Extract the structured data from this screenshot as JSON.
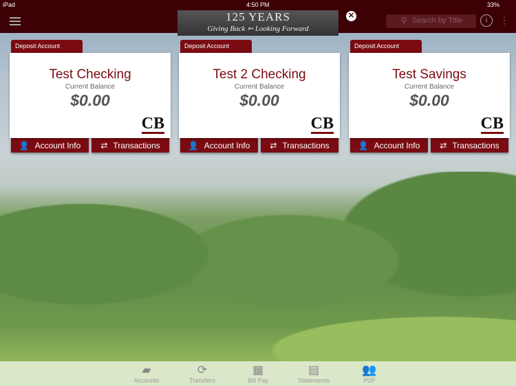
{
  "status": {
    "device": "iPad",
    "time": "4:50 PM",
    "battery": "33%"
  },
  "banner": {
    "line1": "125 YEARS",
    "line2": "Giving Back ➳ Looking Forward"
  },
  "search": {
    "placeholder": "Search by Title"
  },
  "accounts": [
    {
      "type": "Deposit Account",
      "name": "Test Checking",
      "balance_label": "Current Balance",
      "balance": "$0.00",
      "logo": "CB",
      "info_label": "Account Info",
      "transactions_label": "Transactions"
    },
    {
      "type": "Deposit Account",
      "name": "Test 2 Checking",
      "balance_label": "Current Balance",
      "balance": "$0.00",
      "logo": "CB",
      "info_label": "Account Info",
      "transactions_label": "Transactions"
    },
    {
      "type": "Deposit Account",
      "name": "Test Savings",
      "balance_label": "Current Balance",
      "balance": "$0.00",
      "logo": "CB",
      "info_label": "Account Info",
      "transactions_label": "Transactions"
    }
  ],
  "tabbar": [
    {
      "label": "Accounts",
      "icon": "cards-icon"
    },
    {
      "label": "Transfers",
      "icon": "refresh-icon"
    },
    {
      "label": "Bill Pay",
      "icon": "calendar-icon"
    },
    {
      "label": "Statements",
      "icon": "pdf-icon"
    },
    {
      "label": "P2P",
      "icon": "people-icon"
    }
  ],
  "colors": {
    "brand": "#7a0b12",
    "nav": "#3d0005"
  }
}
